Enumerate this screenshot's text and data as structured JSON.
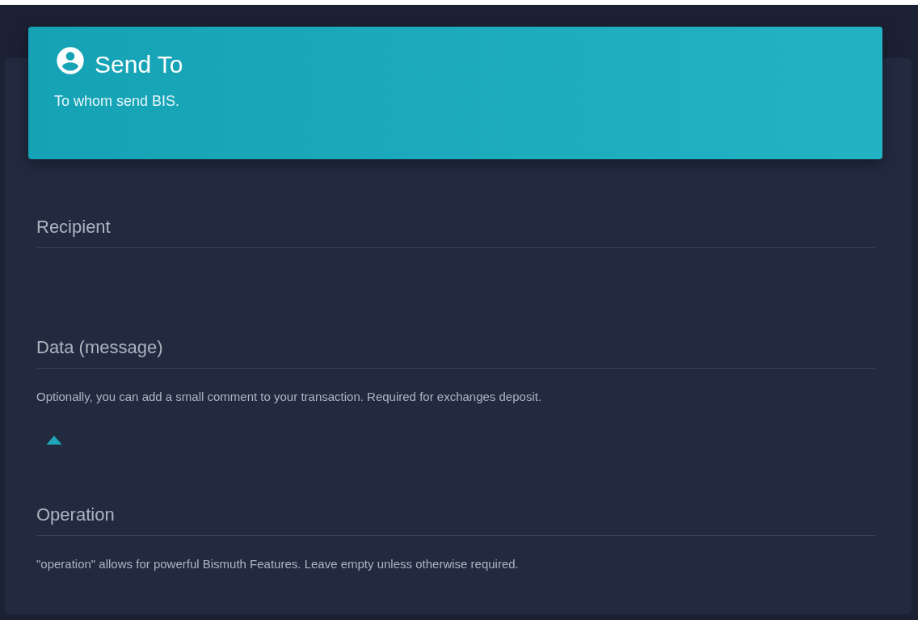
{
  "header": {
    "title": "Send To",
    "subtitle": "To whom send BIS."
  },
  "fields": [
    {
      "placeholder": "Recipient"
    },
    {
      "placeholder": "Data (message)",
      "expanded": true,
      "helper": "Optionally, you can add a small comment to your transaction. Required for exchanges deposit."
    },
    {
      "placeholder": "Operation",
      "helper": "\"operation\" allows for powerful Bismuth Features. Leave empty unless otherwise required."
    }
  ]
}
